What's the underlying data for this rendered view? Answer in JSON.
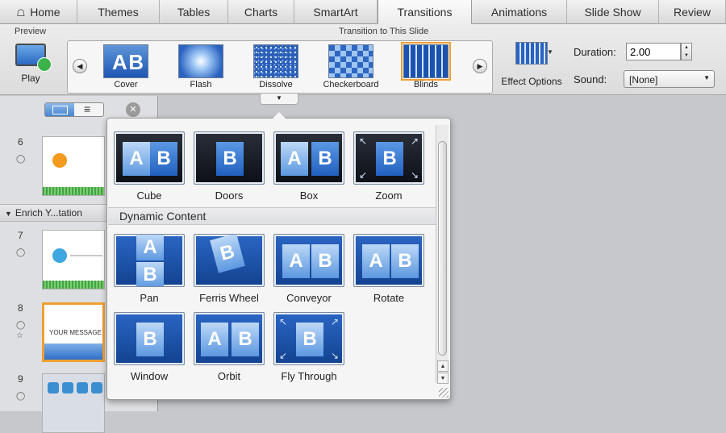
{
  "tabs": [
    {
      "label": "Home",
      "icon": "home-icon"
    },
    {
      "label": "Themes"
    },
    {
      "label": "Tables"
    },
    {
      "label": "Charts"
    },
    {
      "label": "SmartArt"
    },
    {
      "label": "Transitions",
      "active": true
    },
    {
      "label": "Animations"
    },
    {
      "label": "Slide Show"
    },
    {
      "label": "Review"
    }
  ],
  "ribbon": {
    "preview_group_label": "Preview",
    "play_label": "Play",
    "transition_group_label": "Transition to This Slide",
    "gallery": [
      {
        "label": "Cover"
      },
      {
        "label": "Flash"
      },
      {
        "label": "Dissolve"
      },
      {
        "label": "Checkerboard"
      },
      {
        "label": "Blinds",
        "selected": true
      }
    ],
    "effect_options_label": "Effect Options",
    "duration_label": "Duration:",
    "duration_value": "2.00",
    "sound_label": "Sound:",
    "sound_value": "[None]"
  },
  "slide_pane": {
    "slides": [
      {
        "number": "6"
      },
      {
        "number": "7"
      },
      {
        "number": "8",
        "selected": true,
        "thumb_text": "YOUR MESSAGE"
      },
      {
        "number": "9"
      }
    ],
    "section_header": "Enrich Y...tation"
  },
  "dropdown": {
    "top_row": [
      {
        "label": "Cube"
      },
      {
        "label": "Doors"
      },
      {
        "label": "Box"
      },
      {
        "label": "Zoom"
      }
    ],
    "section_title": "Dynamic Content",
    "dynamic_row1": [
      {
        "label": "Pan"
      },
      {
        "label": "Ferris Wheel"
      },
      {
        "label": "Conveyor"
      },
      {
        "label": "Rotate"
      }
    ],
    "dynamic_row2": [
      {
        "label": "Window"
      },
      {
        "label": "Orbit"
      },
      {
        "label": "Fly Through"
      }
    ]
  },
  "colors": {
    "accent_selected": "#f0a033",
    "transition_blue": "#2b66c4"
  }
}
